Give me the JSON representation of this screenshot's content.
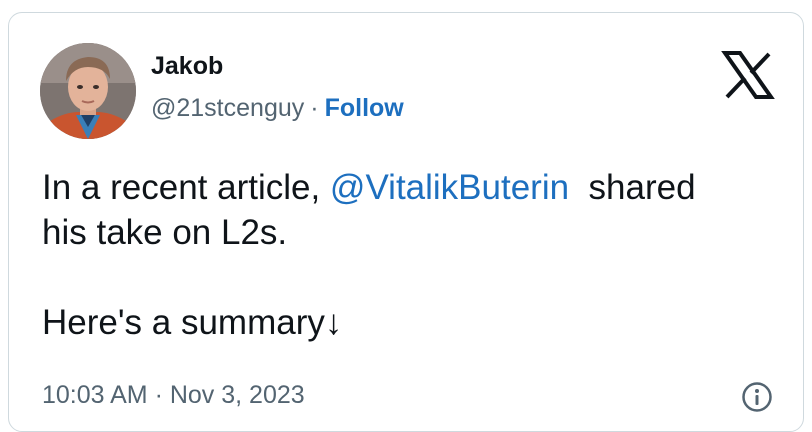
{
  "author": {
    "name": "Jakob",
    "handle": "@21stcenguy",
    "separator": "·",
    "follow_label": "Follow"
  },
  "brand": {
    "logo_icon": "x-logo-icon",
    "accent_color": "#1d6fbf"
  },
  "tweet": {
    "line1_prefix": "In a recent article, ",
    "mention": "@VitalikButerin",
    "line1_suffix": "  shared",
    "line2": "his take on L2s.",
    "line4": "Here's a summary↓"
  },
  "footer": {
    "timestamp": "10:03 AM · Nov 3, 2023",
    "info_icon": "info-icon"
  }
}
